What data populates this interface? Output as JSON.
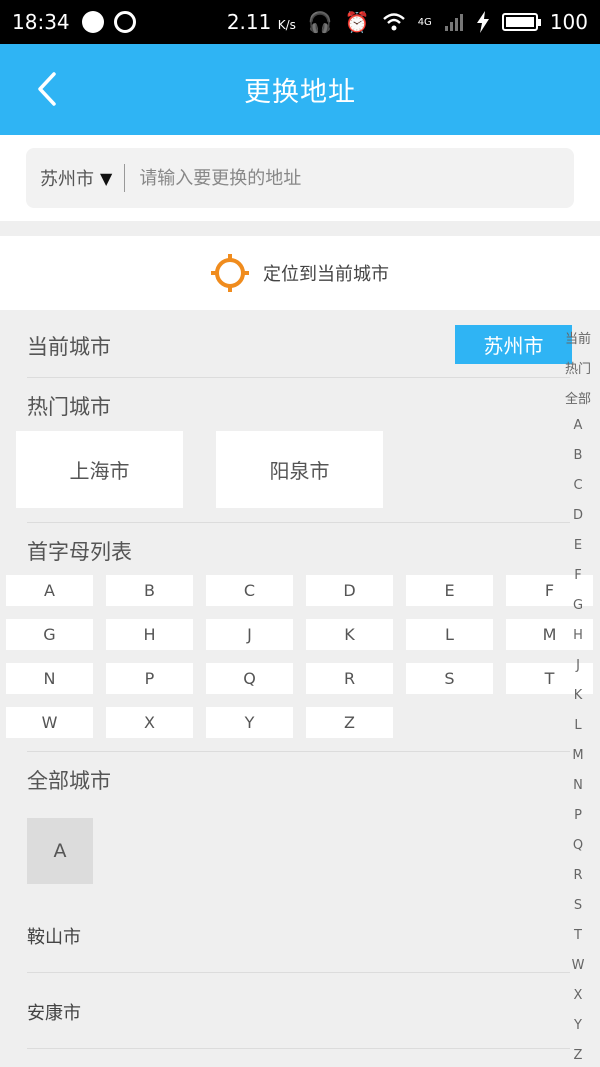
{
  "status_bar": {
    "time": "18:34",
    "speed": "2.11",
    "speed_unit": "K/s",
    "network": "4G",
    "battery": "100",
    "battery_level": 1.0
  },
  "header": {
    "title": "更换地址",
    "back_icon": "chevron-left-icon"
  },
  "search": {
    "city": "苏州市",
    "city_arrow": "▼",
    "placeholder": "请输入要更换的地址"
  },
  "locate": {
    "label": "定位到当前城市",
    "icon": "crosshair-icon",
    "icon_color": "#f08c1e"
  },
  "sections": {
    "current_city_title": "当前城市",
    "current_city": "苏州市",
    "hot_title": "热门城市",
    "letters_title": "首字母列表",
    "all_title": "全部城市"
  },
  "hot_cities": [
    "上海市",
    "阳泉市"
  ],
  "letters": [
    "A",
    "B",
    "C",
    "D",
    "E",
    "F",
    "G",
    "H",
    "J",
    "K",
    "L",
    "M",
    "N",
    "P",
    "Q",
    "R",
    "S",
    "T",
    "W",
    "X",
    "Y",
    "Z"
  ],
  "all_cities": {
    "group_letter": "A",
    "items": [
      "鞍山市",
      "安康市"
    ]
  },
  "index_bar": [
    "当前",
    "热门",
    "全部",
    "A",
    "B",
    "C",
    "D",
    "E",
    "F",
    "G",
    "H",
    "J",
    "K",
    "L",
    "M",
    "N",
    "P",
    "Q",
    "R",
    "S",
    "T",
    "W",
    "X",
    "Y",
    "Z"
  ],
  "colors": {
    "accent": "#2fb4f4",
    "background": "#efefef"
  }
}
